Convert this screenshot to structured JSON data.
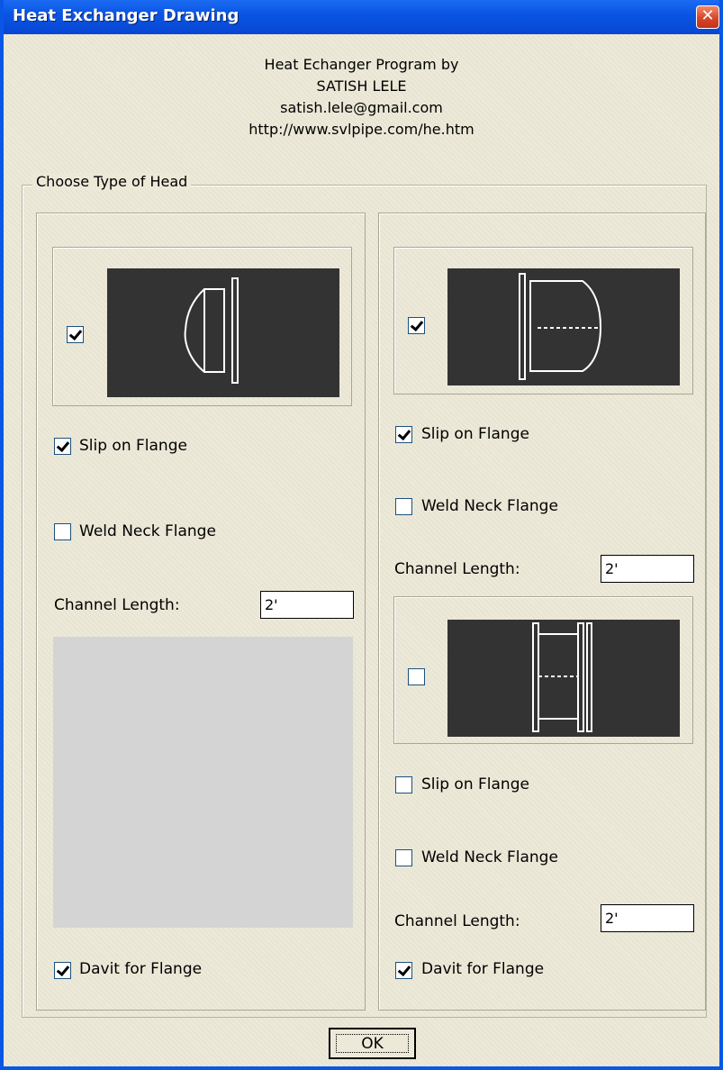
{
  "window": {
    "title": "Heat Exchanger Drawing",
    "close_glyph": "✕"
  },
  "credits": {
    "line1": "Heat Echanger Program by",
    "line2": "SATISH LELE",
    "line3": "satish.lele@gmail.com",
    "line4": "http://www.svlpipe.com/he.htm"
  },
  "group": {
    "legend": "Choose Type of Head"
  },
  "left_panel": {
    "head_selected": true,
    "slip_on_label": "Slip on Flange",
    "slip_on_checked": true,
    "weld_neck_label": "Weld Neck Flange",
    "weld_neck_checked": false,
    "channel_length_label": "Channel Length:",
    "channel_length_value": "2'",
    "davit_label": "Davit for Flange",
    "davit_checked": true
  },
  "right_panel": {
    "head_a": {
      "selected": true,
      "slip_on_label": "Slip on Flange",
      "slip_on_checked": true,
      "weld_neck_label": "Weld Neck Flange",
      "weld_neck_checked": false,
      "channel_length_label": "Channel Length:",
      "channel_length_value": "2'"
    },
    "head_b": {
      "selected": false,
      "slip_on_label": "Slip on Flange",
      "slip_on_checked": false,
      "weld_neck_label": "Weld Neck Flange",
      "weld_neck_checked": false,
      "channel_length_label": "Channel Length:",
      "channel_length_value": "2'"
    },
    "davit_label": "Davit for Flange",
    "davit_checked": true
  },
  "buttons": {
    "ok_label": "OK"
  },
  "colors": {
    "title_bar": "#0a55e4",
    "dialog_bg": "#ece9d8",
    "drawing_bg": "#333333",
    "close_button": "#d8452b"
  }
}
